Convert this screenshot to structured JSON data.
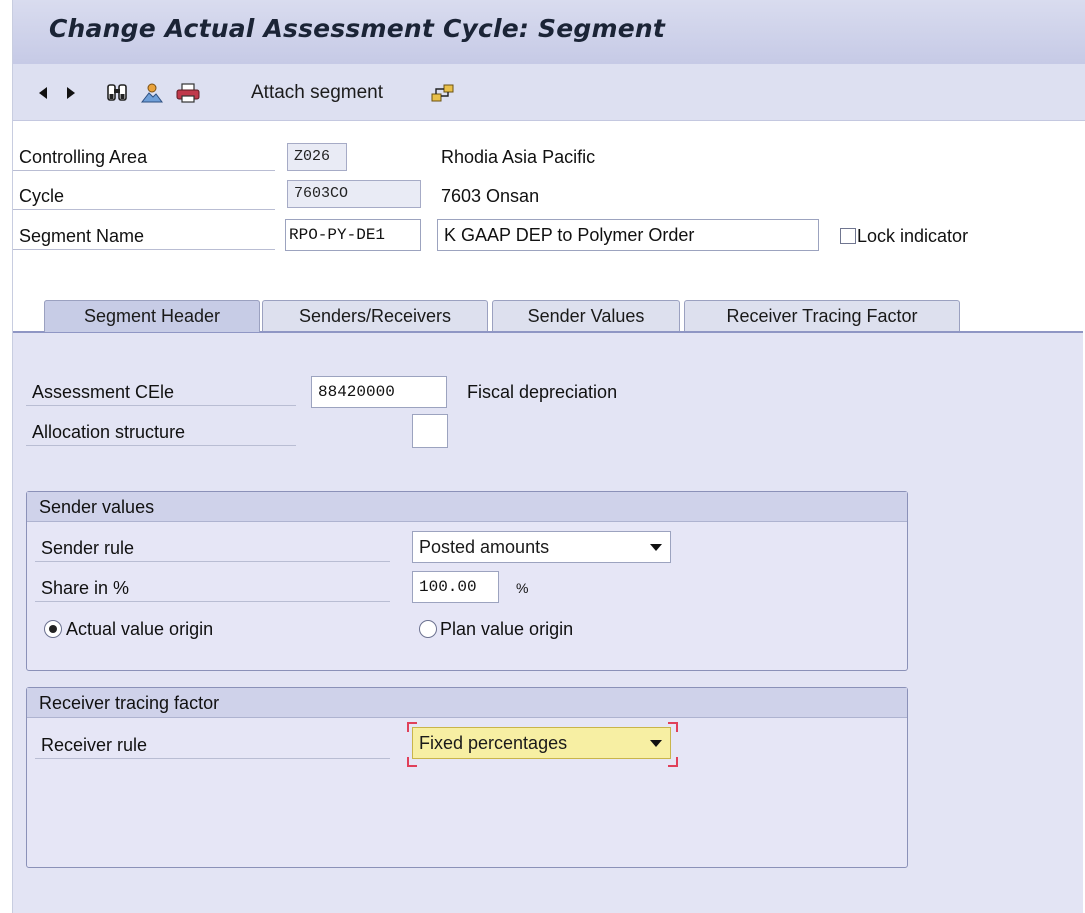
{
  "window": {
    "title": "Change Actual Assessment Cycle: Segment"
  },
  "toolbar": {
    "items": [
      {
        "icon": "arrow-left-icon"
      },
      {
        "icon": "arrow-right-icon"
      },
      {
        "icon": "binoculars-icon"
      },
      {
        "icon": "user-mountain-icon"
      },
      {
        "icon": "print-icon"
      },
      {
        "label": "Attach segment"
      },
      {
        "icon": "hierarchy-icon"
      }
    ]
  },
  "header": {
    "controlling_area": {
      "label": "Controlling Area",
      "value": "Z026",
      "description": "Rhodia Asia Pacific"
    },
    "cycle": {
      "label": "Cycle",
      "value": "7603CO",
      "description": "7603 Onsan"
    },
    "segment_name": {
      "label": "Segment Name",
      "value": "RPO-PY-DE1",
      "description": "K GAAP DEP to Polymer Order"
    },
    "lock_indicator": {
      "label": "Lock indicator",
      "checked": false
    }
  },
  "tabs": [
    {
      "label": "Segment Header",
      "active": true
    },
    {
      "label": "Senders/Receivers",
      "active": false
    },
    {
      "label": "Sender Values",
      "active": false
    },
    {
      "label": "Receiver Tracing Factor",
      "active": false
    }
  ],
  "segment_header": {
    "assessment_cele": {
      "label": "Assessment CEle",
      "value": "88420000",
      "description": "Fiscal depreciation"
    },
    "allocation_structure": {
      "label": "Allocation structure",
      "value": ""
    }
  },
  "sender_values": {
    "title": "Sender values",
    "sender_rule": {
      "label": "Sender rule",
      "value": "Posted amounts"
    },
    "share": {
      "label": "Share in %",
      "value": "100.00",
      "unit": "%"
    },
    "actual_origin": {
      "label": "Actual value origin",
      "selected": true
    },
    "plan_origin": {
      "label": "Plan value origin",
      "selected": false
    }
  },
  "receiver_tracing": {
    "title": "Receiver tracing factor",
    "receiver_rule": {
      "label": "Receiver rule",
      "value": "Fixed percentages"
    }
  },
  "colors": {
    "title_bar": "#c6cae6",
    "tab_panel": "#e3e4f4",
    "focus_field": "#f7efa3",
    "required_marker": "#e0405a"
  }
}
